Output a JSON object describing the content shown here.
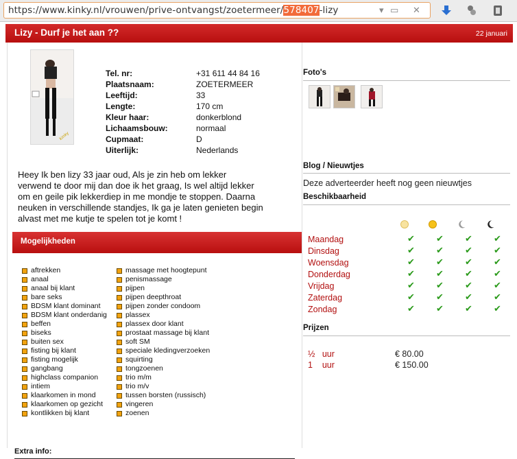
{
  "browser": {
    "url_prefix": "https://www.kinky.nl/vrouwen/prive-ontvangst/zoetermeer/",
    "url_highlight": "578407",
    "url_suffix": "-lizy"
  },
  "ad": {
    "title": "Lizy - Durf je het aan ??",
    "date": "22 januari",
    "facts": [
      {
        "label": "Tel. nr:",
        "value": "+31 611 44 84 16"
      },
      {
        "label": "Plaatsnaam:",
        "value": "ZOETERMEER"
      },
      {
        "label": "Leeftijd:",
        "value": "33"
      },
      {
        "label": "Lengte:",
        "value": "170 cm"
      },
      {
        "label": "Kleur haar:",
        "value": "donkerblond"
      },
      {
        "label": "Lichaamsbouw:",
        "value": "normaal"
      },
      {
        "label": "Cupmaat:",
        "value": "D"
      },
      {
        "label": "Uiterlijk:",
        "value": "Nederlands"
      }
    ],
    "bio_lines": [
      "Heey Ik ben lizy 33 jaar oud, Als je zin heb om lekker",
      "verwend te door mij dan doe ik het graag, Is wel altijd lekker",
      "om en geile pik lekkerdiep in me mondje te stoppen. Daarna",
      "neuken in verschillende standjes, Ik ga je laten genieten begin",
      "alvast met me kutje te spelen tot je komt !"
    ],
    "mog_title": "Mogelijkheden",
    "options_col1": [
      "aftrekken",
      "anaal",
      "anaal bij klant",
      "bare seks",
      "BDSM klant dominant",
      "BDSM klant onderdanig",
      "beffen",
      "biseks",
      "buiten sex",
      "fisting bij klant",
      "fisting mogelijk",
      "gangbang",
      "highclass companion",
      "intiem",
      "klaarkomen in mond",
      "klaarkomen op gezicht",
      "kontlikken bij klant"
    ],
    "options_col2": [
      "massage met hoogtepunt",
      "penismassage",
      "pijpen",
      "pijpen deepthroat",
      "pijpen zonder condoom",
      "plassex",
      "plassex door klant",
      "prostaat massage bij klant",
      "soft SM",
      "speciale kledingverzoeken",
      "squirting",
      "tongzoenen",
      "trio m/m",
      "trio m/v",
      "tussen borsten (russisch)",
      "vingeren",
      "zoenen"
    ],
    "extra_title": "Extra info:"
  },
  "sidebar": {
    "photos_title": "Foto's",
    "blog_title": "Blog / Nieuwtjes",
    "blog_msg": "Deze adverteerder heeft nog geen nieuwtjes",
    "avail_title": "Beschikbaarheid",
    "days": [
      "Maandag",
      "Dinsdag",
      "Woensdag",
      "Donderdag",
      "Vrijdag",
      "Zaterdag",
      "Zondag"
    ],
    "check": "✔",
    "prices_title": "Prijzen",
    "prices": [
      {
        "qty": "½",
        "unit": "uur",
        "price": "€ 80.00"
      },
      {
        "qty": "1",
        "unit": "uur",
        "price": "€ 150.00"
      }
    ]
  }
}
